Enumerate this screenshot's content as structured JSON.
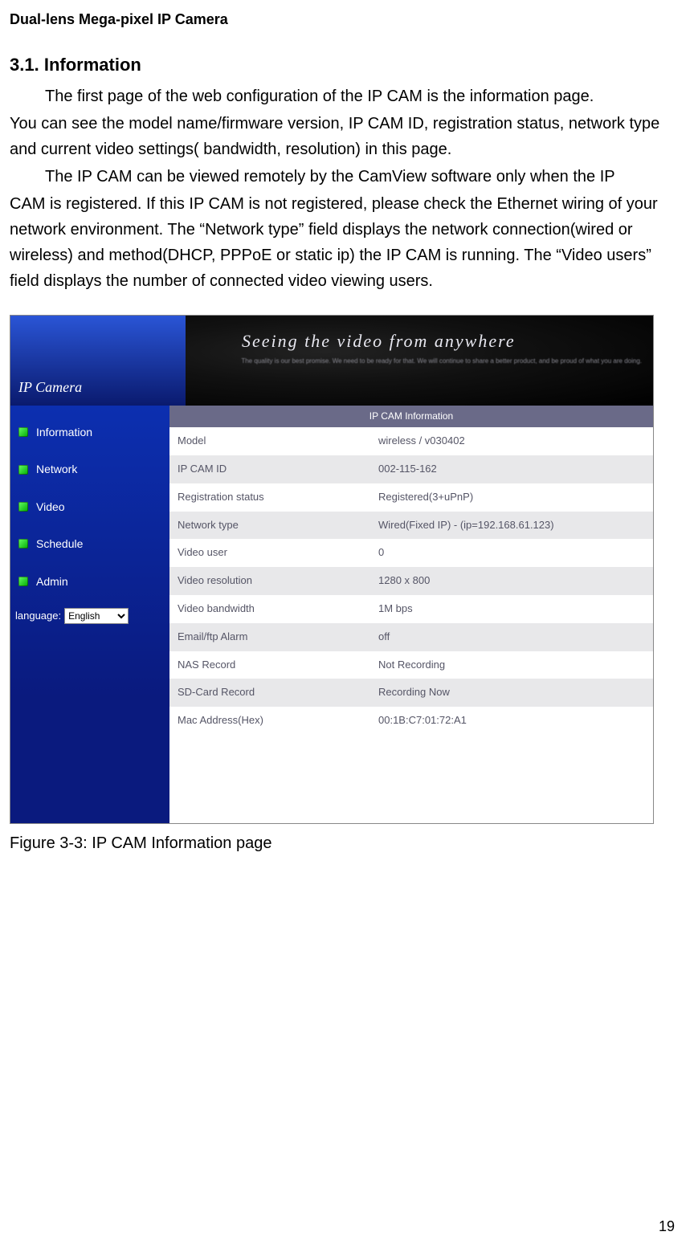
{
  "doc_header": "Dual-lens Mega-pixel IP Camera",
  "section_number": "3.1.",
  "section_title": "Information",
  "paragraph1_line1": "The first page of the web configuration of the IP CAM is the information page.",
  "paragraph1_rest": "You can see the model name/firmware version, IP CAM ID, registration status, network type and current video settings( bandwidth, resolution) in this page.",
  "paragraph2_line1": "The IP CAM can be viewed remotely by the CamView software only when the IP",
  "paragraph2_rest": "CAM is registered. If this IP CAM is not registered, please check the Ethernet wiring of your network environment. The “Network type” field displays the network connection(wired or wireless) and method(DHCP, PPPoE or static ip) the IP CAM is running. The “Video users” field displays the number of connected video viewing users.",
  "figure": {
    "logo": "IP Camera",
    "tagline": "Seeing the video from anywhere",
    "blurb": "The quality is our best promise.\nWe need to be ready for that.\nWe will continue to share a better product,\nand be proud of what you are doing.",
    "sidebar": {
      "items": [
        "Information",
        "Network",
        "Video",
        "Schedule",
        "Admin"
      ],
      "language_label": "language:",
      "language_value": "English"
    },
    "panel_title": "IP CAM Information",
    "rows": [
      {
        "label": "Model",
        "value": "wireless / v030402"
      },
      {
        "label": "IP CAM ID",
        "value": "002-115-162"
      },
      {
        "label": "Registration status",
        "value": "Registered(3+uPnP)"
      },
      {
        "label": "Network type",
        "value": "Wired(Fixed IP) - (ip=192.168.61.123)"
      },
      {
        "label": "Video user",
        "value": "0"
      },
      {
        "label": "Video resolution",
        "value": "1280 x 800"
      },
      {
        "label": "Video bandwidth",
        "value": "1M bps"
      },
      {
        "label": "Email/ftp Alarm",
        "value": "off"
      },
      {
        "label": "NAS Record",
        "value": "Not Recording"
      },
      {
        "label": "SD-Card Record",
        "value": "Recording Now"
      },
      {
        "label": "Mac Address(Hex)",
        "value": "00:1B:C7:01:72:A1"
      }
    ]
  },
  "figure_caption": "Figure 3-3: IP CAM Information page",
  "page_number": "19"
}
